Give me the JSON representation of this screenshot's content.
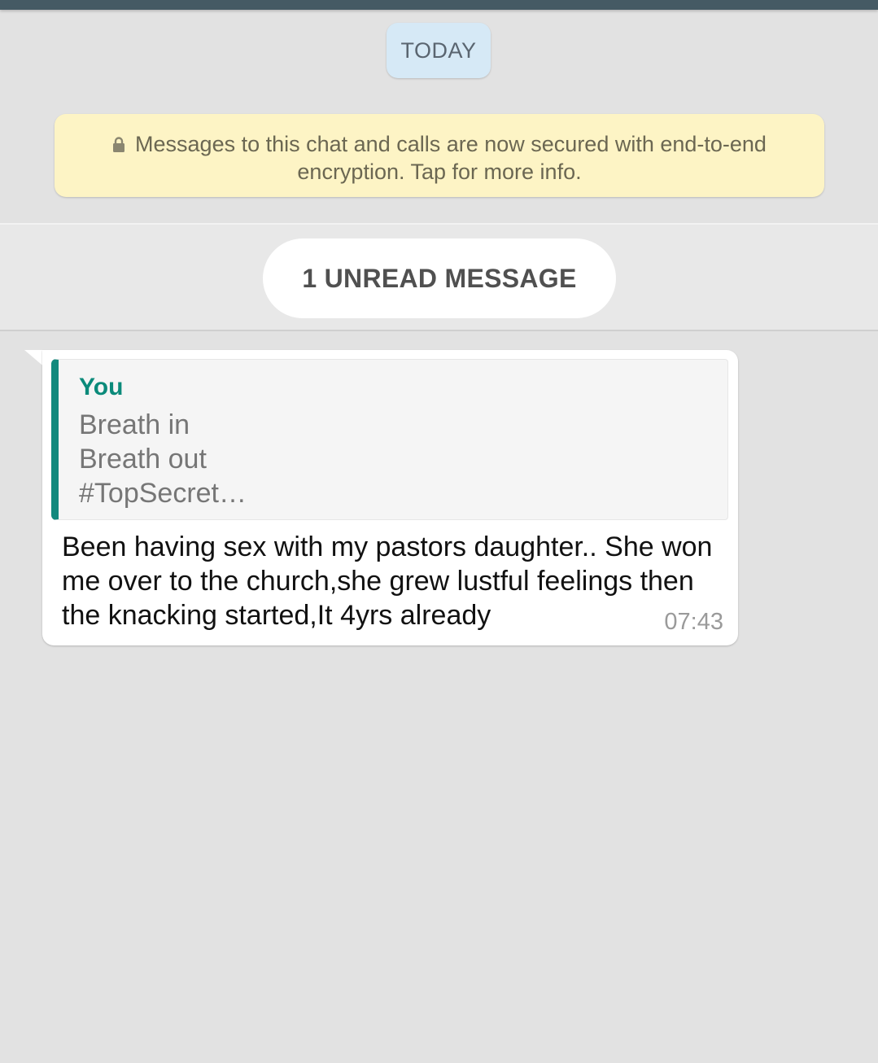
{
  "date_chip": "TODAY",
  "encryption_notice": {
    "icon": "lock-icon",
    "line1": "Messages to this chat and calls are now secured with end-to-end",
    "line2": "encryption. Tap for more info."
  },
  "unread_banner": "1 UNREAD MESSAGE",
  "message": {
    "quote": {
      "author": "You",
      "lines": [
        "Breath in",
        "Breath out",
        "#TopSecret…"
      ]
    },
    "text": "Been having sex with my pastors daughter.. She won me over to the church,she grew lustful feelings then the knacking started,It 4yrs already",
    "time": "07:43"
  },
  "colors": {
    "top_bar": "#455a64",
    "background": "#e2e2e2",
    "date_chip_bg": "#d6e9f6",
    "notice_bg": "#fdf4c5",
    "quote_accent": "#12897d",
    "quote_author": "#0b8a7a"
  }
}
